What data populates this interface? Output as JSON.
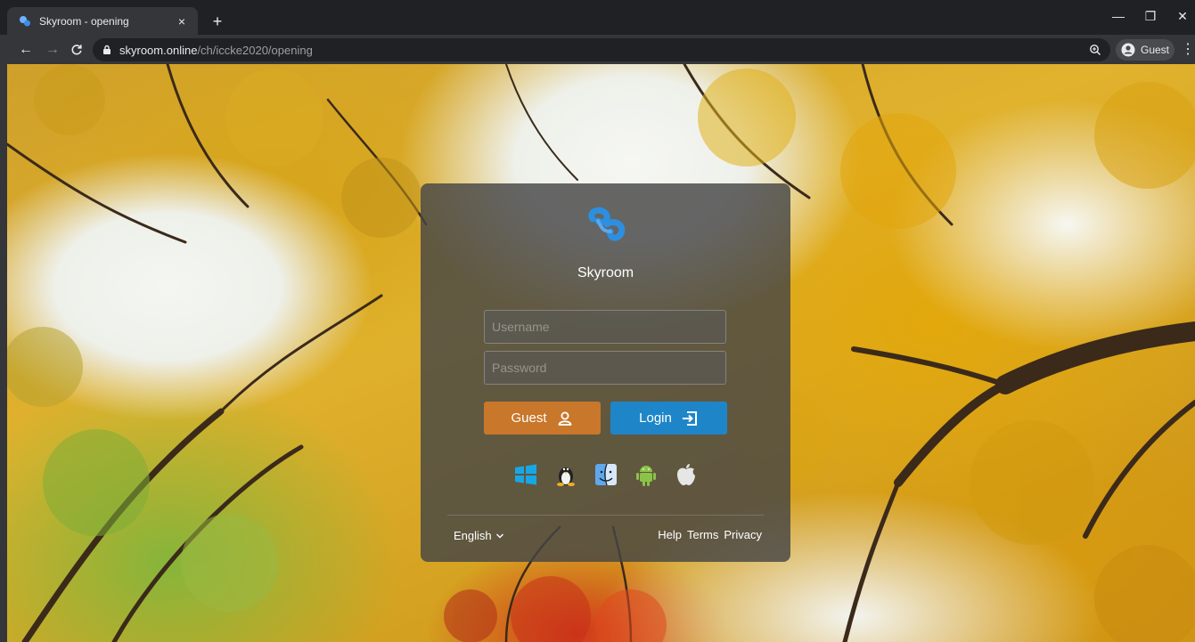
{
  "browser": {
    "tab_title": "Skyroom - opening",
    "tab_close": "×",
    "new_tab": "+",
    "url_host": "skyroom.online",
    "url_path": "/ch/iccke2020/opening",
    "profile_label": "Guest",
    "window": {
      "minimize": "—",
      "restore": "❐",
      "close": "✕"
    },
    "nav": {
      "back": "←",
      "forward": "→",
      "reload": "C"
    },
    "menu": "⋮"
  },
  "login": {
    "brand": "Skyroom",
    "username_placeholder": "Username",
    "password_placeholder": "Password",
    "guest_label": "Guest",
    "login_label": "Login",
    "platforms": [
      "windows-icon",
      "linux-icon",
      "macos-finder-icon",
      "android-icon",
      "apple-icon"
    ],
    "language": "English",
    "links": {
      "help": "Help",
      "terms": "Terms",
      "privacy": "Privacy"
    }
  },
  "colors": {
    "brand_blue": "#1e86c8",
    "guest_orange": "#c9772a",
    "panel_bg": "rgba(70,70,70,0.82)",
    "chrome_dark": "#202124"
  }
}
